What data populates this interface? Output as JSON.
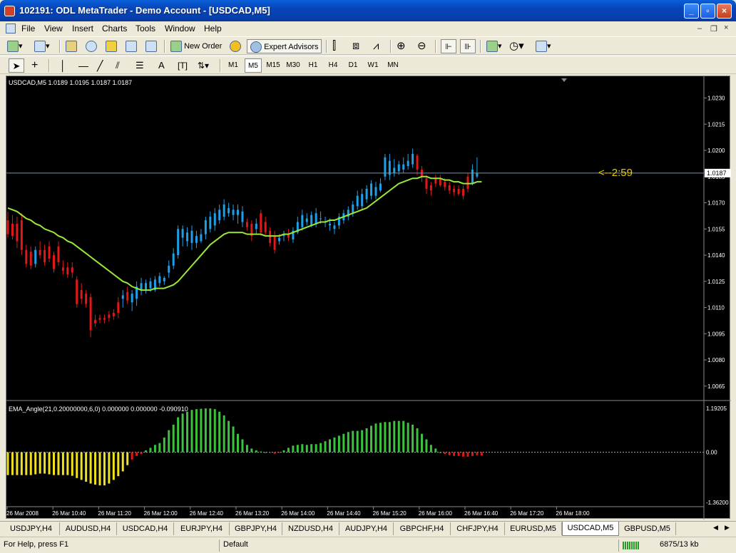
{
  "window": {
    "title": "102191: ODL MetaTrader - Demo Account - [USDCAD,M5]"
  },
  "menu": [
    "File",
    "View",
    "Insert",
    "Charts",
    "Tools",
    "Window",
    "Help"
  ],
  "toolbar": {
    "new_order": "New Order",
    "expert_advisors": "Expert Advisors"
  },
  "timeframes": [
    "M1",
    "M5",
    "M15",
    "M30",
    "H1",
    "H4",
    "D1",
    "W1",
    "MN"
  ],
  "active_timeframe": "M5",
  "chart": {
    "header": "USDCAD,M5  1.0189 1.0195 1.0187 1.0187",
    "current_price": "1.0187",
    "countdown": "<--2:59",
    "price_ticks": [
      "1.0230",
      "1.0215",
      "1.0200",
      "1.0185",
      "1.0170",
      "1.0155",
      "1.0140",
      "1.0125",
      "1.0110",
      "1.0095",
      "1.0080",
      "1.0065"
    ],
    "indicator_header": "EMA_Angle(21,0.20000000,6,0) 0.000000 0.000000 -0.090910",
    "indicator_ticks": [
      "1.19205",
      "0.00",
      "-1.36200"
    ],
    "time_ticks": [
      "26 Mar 2008",
      "26 Mar 10:40",
      "26 Mar 11:20",
      "26 Mar 12:00",
      "26 Mar 12:40",
      "26 Mar 13:20",
      "26 Mar 14:00",
      "26 Mar 14:40",
      "26 Mar 15:20",
      "26 Mar 16:00",
      "26 Mar 16:40",
      "26 Mar 17:20",
      "26 Mar 18:00"
    ],
    "colors": {
      "bull": "#1ea0e8",
      "bear": "#e01818",
      "ema": "#9ae639",
      "ind_pos": "#3cc23c",
      "ind_neg_yellow": "#f0e020",
      "ind_neg_red": "#e01818",
      "countdown": "#e6c800"
    }
  },
  "chart_data": {
    "type": "candlestick",
    "symbol": "USDCAD",
    "timeframe": "M5",
    "ylim": [
      1.0058,
      1.024
    ],
    "bars": [
      {
        "o": 1.016,
        "h": 1.0165,
        "l": 1.015,
        "c": 1.0152
      },
      {
        "o": 1.0158,
        "h": 1.0163,
        "l": 1.0149,
        "c": 1.0151
      },
      {
        "o": 1.0158,
        "h": 1.0162,
        "l": 1.0144,
        "c": 1.0148
      },
      {
        "o": 1.016,
        "h": 1.0164,
        "l": 1.014,
        "c": 1.0143
      },
      {
        "o": 1.0143,
        "h": 1.0146,
        "l": 1.0133,
        "c": 1.0135
      },
      {
        "o": 1.0142,
        "h": 1.0145,
        "l": 1.0132,
        "c": 1.0134
      },
      {
        "o": 1.0135,
        "h": 1.0145,
        "l": 1.0133,
        "c": 1.0143
      },
      {
        "o": 1.0143,
        "h": 1.0148,
        "l": 1.0138,
        "c": 1.014
      },
      {
        "o": 1.0143,
        "h": 1.0146,
        "l": 1.0134,
        "c": 1.0136
      },
      {
        "o": 1.0145,
        "h": 1.0148,
        "l": 1.0136,
        "c": 1.0138
      },
      {
        "o": 1.014,
        "h": 1.0142,
        "l": 1.013,
        "c": 1.0132
      },
      {
        "o": 1.0145,
        "h": 1.0148,
        "l": 1.0134,
        "c": 1.0136
      },
      {
        "o": 1.0133,
        "h": 1.0137,
        "l": 1.0129,
        "c": 1.0131
      },
      {
        "o": 1.0133,
        "h": 1.0136,
        "l": 1.0127,
        "c": 1.0129
      },
      {
        "o": 1.0133,
        "h": 1.0136,
        "l": 1.0127,
        "c": 1.013
      },
      {
        "o": 1.0126,
        "h": 1.0128,
        "l": 1.011,
        "c": 1.0112
      },
      {
        "o": 1.012,
        "h": 1.0124,
        "l": 1.0112,
        "c": 1.0115
      },
      {
        "o": 1.0118,
        "h": 1.012,
        "l": 1.011,
        "c": 1.0112
      },
      {
        "o": 1.0116,
        "h": 1.0118,
        "l": 1.0093,
        "c": 1.0097
      },
      {
        "o": 1.0103,
        "h": 1.0106,
        "l": 1.0099,
        "c": 1.0101
      },
      {
        "o": 1.0104,
        "h": 1.0106,
        "l": 1.0101,
        "c": 1.0103
      },
      {
        "o": 1.0104,
        "h": 1.0106,
        "l": 1.0101,
        "c": 1.0103
      },
      {
        "o": 1.0106,
        "h": 1.0108,
        "l": 1.0102,
        "c": 1.0104
      },
      {
        "o": 1.0107,
        "h": 1.0109,
        "l": 1.0103,
        "c": 1.0105
      },
      {
        "o": 1.0113,
        "h": 1.0116,
        "l": 1.0104,
        "c": 1.0107
      },
      {
        "o": 1.0115,
        "h": 1.012,
        "l": 1.011,
        "c": 1.0117
      },
      {
        "o": 1.0119,
        "h": 1.0122,
        "l": 1.0112,
        "c": 1.0114
      },
      {
        "o": 1.0113,
        "h": 1.012,
        "l": 1.0108,
        "c": 1.0118
      },
      {
        "o": 1.0115,
        "h": 1.0125,
        "l": 1.0111,
        "c": 1.0122
      },
      {
        "o": 1.012,
        "h": 1.0127,
        "l": 1.0117,
        "c": 1.0124
      },
      {
        "o": 1.012,
        "h": 1.0126,
        "l": 1.0118,
        "c": 1.0124
      },
      {
        "o": 1.0121,
        "h": 1.0127,
        "l": 1.0119,
        "c": 1.0125
      },
      {
        "o": 1.012,
        "h": 1.0128,
        "l": 1.0119,
        "c": 1.0126
      },
      {
        "o": 1.0124,
        "h": 1.013,
        "l": 1.0122,
        "c": 1.0128
      },
      {
        "o": 1.0125,
        "h": 1.0128,
        "l": 1.0123,
        "c": 1.0127
      },
      {
        "o": 1.013,
        "h": 1.0137,
        "l": 1.0127,
        "c": 1.0134
      },
      {
        "o": 1.0134,
        "h": 1.0144,
        "l": 1.0132,
        "c": 1.0141
      },
      {
        "o": 1.014,
        "h": 1.0157,
        "l": 1.0138,
        "c": 1.0155
      },
      {
        "o": 1.015,
        "h": 1.0157,
        "l": 1.0145,
        "c": 1.0155
      },
      {
        "o": 1.0148,
        "h": 1.0156,
        "l": 1.0145,
        "c": 1.0153
      },
      {
        "o": 1.0147,
        "h": 1.0157,
        "l": 1.0143,
        "c": 1.0154
      },
      {
        "o": 1.0147,
        "h": 1.0154,
        "l": 1.0144,
        "c": 1.0151
      },
      {
        "o": 1.0148,
        "h": 1.0155,
        "l": 1.0147,
        "c": 1.0152
      },
      {
        "o": 1.0152,
        "h": 1.0162,
        "l": 1.0149,
        "c": 1.016
      },
      {
        "o": 1.0155,
        "h": 1.0165,
        "l": 1.0153,
        "c": 1.0162
      },
      {
        "o": 1.0157,
        "h": 1.0167,
        "l": 1.0154,
        "c": 1.0164
      },
      {
        "o": 1.016,
        "h": 1.0169,
        "l": 1.0158,
        "c": 1.0166
      },
      {
        "o": 1.0162,
        "h": 1.0172,
        "l": 1.016,
        "c": 1.0169
      },
      {
        "o": 1.0164,
        "h": 1.017,
        "l": 1.0162,
        "c": 1.0167
      },
      {
        "o": 1.0163,
        "h": 1.0169,
        "l": 1.016,
        "c": 1.0166
      },
      {
        "o": 1.0163,
        "h": 1.0169,
        "l": 1.0158,
        "c": 1.0166
      },
      {
        "o": 1.0159,
        "h": 1.0168,
        "l": 1.0156,
        "c": 1.0165
      },
      {
        "o": 1.0159,
        "h": 1.0161,
        "l": 1.0154,
        "c": 1.0156
      },
      {
        "o": 1.0158,
        "h": 1.016,
        "l": 1.0148,
        "c": 1.0151
      },
      {
        "o": 1.0155,
        "h": 1.0161,
        "l": 1.0152,
        "c": 1.0158
      },
      {
        "o": 1.0164,
        "h": 1.0166,
        "l": 1.0151,
        "c": 1.0153
      },
      {
        "o": 1.0159,
        "h": 1.0162,
        "l": 1.0151,
        "c": 1.0153
      },
      {
        "o": 1.0154,
        "h": 1.0156,
        "l": 1.0145,
        "c": 1.0147
      },
      {
        "o": 1.0151,
        "h": 1.0154,
        "l": 1.0141,
        "c": 1.0143
      },
      {
        "o": 1.0148,
        "h": 1.0152,
        "l": 1.0146,
        "c": 1.015
      },
      {
        "o": 1.0151,
        "h": 1.0154,
        "l": 1.0148,
        "c": 1.0152
      },
      {
        "o": 1.0152,
        "h": 1.0155,
        "l": 1.0148,
        "c": 1.015
      },
      {
        "o": 1.0149,
        "h": 1.0156,
        "l": 1.0147,
        "c": 1.0154
      },
      {
        "o": 1.0153,
        "h": 1.0162,
        "l": 1.0152,
        "c": 1.0159
      },
      {
        "o": 1.0156,
        "h": 1.0166,
        "l": 1.0154,
        "c": 1.0163
      },
      {
        "o": 1.0159,
        "h": 1.0164,
        "l": 1.0157,
        "c": 1.0161
      },
      {
        "o": 1.0157,
        "h": 1.0165,
        "l": 1.0156,
        "c": 1.0163
      },
      {
        "o": 1.0158,
        "h": 1.0167,
        "l": 1.0156,
        "c": 1.0164
      },
      {
        "o": 1.0161,
        "h": 1.0165,
        "l": 1.0158,
        "c": 1.0161
      },
      {
        "o": 1.0159,
        "h": 1.0162,
        "l": 1.0156,
        "c": 1.0159
      },
      {
        "o": 1.0157,
        "h": 1.0161,
        "l": 1.0154,
        "c": 1.0158
      },
      {
        "o": 1.0155,
        "h": 1.0159,
        "l": 1.0152,
        "c": 1.0157
      },
      {
        "o": 1.0157,
        "h": 1.0164,
        "l": 1.0155,
        "c": 1.0162
      },
      {
        "o": 1.016,
        "h": 1.0166,
        "l": 1.0158,
        "c": 1.0164
      },
      {
        "o": 1.0162,
        "h": 1.0168,
        "l": 1.016,
        "c": 1.0166
      },
      {
        "o": 1.0164,
        "h": 1.0171,
        "l": 1.0162,
        "c": 1.0169
      },
      {
        "o": 1.0168,
        "h": 1.0177,
        "l": 1.0166,
        "c": 1.0174
      },
      {
        "o": 1.0168,
        "h": 1.0178,
        "l": 1.0166,
        "c": 1.0175
      },
      {
        "o": 1.0172,
        "h": 1.018,
        "l": 1.017,
        "c": 1.0178
      },
      {
        "o": 1.0174,
        "h": 1.0183,
        "l": 1.0172,
        "c": 1.0181
      },
      {
        "o": 1.0174,
        "h": 1.0182,
        "l": 1.0172,
        "c": 1.0179
      },
      {
        "o": 1.0177,
        "h": 1.0184,
        "l": 1.0176,
        "c": 1.0181
      },
      {
        "o": 1.0185,
        "h": 1.0198,
        "l": 1.0183,
        "c": 1.0196
      },
      {
        "o": 1.0186,
        "h": 1.0198,
        "l": 1.0183,
        "c": 1.0194
      },
      {
        "o": 1.0187,
        "h": 1.0195,
        "l": 1.0185,
        "c": 1.019
      },
      {
        "o": 1.0188,
        "h": 1.0194,
        "l": 1.0186,
        "c": 1.0192
      },
      {
        "o": 1.0189,
        "h": 1.0196,
        "l": 1.0187,
        "c": 1.0192
      },
      {
        "o": 1.0191,
        "h": 1.0198,
        "l": 1.0189,
        "c": 1.0194
      },
      {
        "o": 1.0192,
        "h": 1.0201,
        "l": 1.019,
        "c": 1.0198
      },
      {
        "o": 1.0197,
        "h": 1.0198,
        "l": 1.0186,
        "c": 1.0189
      },
      {
        "o": 1.0189,
        "h": 1.0191,
        "l": 1.0182,
        "c": 1.0185
      },
      {
        "o": 1.0184,
        "h": 1.0186,
        "l": 1.0175,
        "c": 1.0178
      },
      {
        "o": 1.018,
        "h": 1.0182,
        "l": 1.0174,
        "c": 1.0177
      },
      {
        "o": 1.0184,
        "h": 1.0186,
        "l": 1.0179,
        "c": 1.0181
      },
      {
        "o": 1.0184,
        "h": 1.0186,
        "l": 1.0179,
        "c": 1.018
      },
      {
        "o": 1.0182,
        "h": 1.0184,
        "l": 1.0177,
        "c": 1.0179
      },
      {
        "o": 1.018,
        "h": 1.0182,
        "l": 1.0175,
        "c": 1.0177
      },
      {
        "o": 1.0178,
        "h": 1.018,
        "l": 1.0174,
        "c": 1.0176
      },
      {
        "o": 1.0178,
        "h": 1.018,
        "l": 1.0174,
        "c": 1.0175
      },
      {
        "o": 1.0178,
        "h": 1.018,
        "l": 1.0172,
        "c": 1.0174
      },
      {
        "o": 1.0185,
        "h": 1.0187,
        "l": 1.0176,
        "c": 1.0178
      },
      {
        "o": 1.0181,
        "h": 1.0192,
        "l": 1.018,
        "c": 1.0189
      },
      {
        "o": 1.0185,
        "h": 1.0196,
        "l": 1.0184,
        "c": 1.0187
      }
    ],
    "ema": [
      1.0167,
      1.0166,
      1.0165,
      1.0163,
      1.0161,
      1.016,
      1.0158,
      1.0157,
      1.0155,
      1.0154,
      1.0153,
      1.0151,
      1.015,
      1.0148,
      1.0147,
      1.0145,
      1.0143,
      1.0141,
      1.0139,
      1.0137,
      1.0135,
      1.0133,
      1.0131,
      1.0129,
      1.0127,
      1.0125,
      1.0124,
      1.0122,
      1.0121,
      1.012,
      1.012,
      1.012,
      1.0121,
      1.0121,
      1.0121,
      1.0122,
      1.0123,
      1.0125,
      1.0128,
      1.0131,
      1.0134,
      1.0137,
      1.014,
      1.0143,
      1.0146,
      1.0148,
      1.015,
      1.0152,
      1.0153,
      1.0153,
      1.0153,
      1.0153,
      1.0152,
      1.0152,
      1.0152,
      1.0152,
      1.0151,
      1.0151,
      1.0151,
      1.0151,
      1.0152,
      1.0152,
      1.0153,
      1.0154,
      1.0155,
      1.0156,
      1.0157,
      1.0158,
      1.0159,
      1.0159,
      1.016,
      1.016,
      1.0161,
      1.0162,
      1.0163,
      1.0164,
      1.0165,
      1.0166,
      1.0167,
      1.0169,
      1.0171,
      1.0173,
      1.0175,
      1.0177,
      1.0179,
      1.0181,
      1.0182,
      1.0183,
      1.0184,
      1.0184,
      1.0185,
      1.0185,
      1.0184,
      1.0184,
      1.0184,
      1.0183,
      1.0183,
      1.0182,
      1.0182,
      1.0181,
      1.0181,
      1.0181,
      1.0182,
      1.0182
    ],
    "indicator": {
      "name": "EMA_Angle(21,0.20000000,6,0)",
      "ylim": [
        -1.362,
        1.19205
      ],
      "values": [
        -0.62,
        -0.62,
        -0.62,
        -0.62,
        -0.62,
        -0.62,
        -0.6,
        -0.58,
        -0.58,
        -0.6,
        -0.62,
        -0.62,
        -0.62,
        -0.62,
        -0.64,
        -0.7,
        -0.75,
        -0.8,
        -0.85,
        -0.88,
        -0.9,
        -0.9,
        -0.85,
        -0.75,
        -0.65,
        -0.52,
        -0.35,
        -0.2,
        -0.1,
        -0.05,
        0.05,
        0.12,
        0.2,
        0.25,
        0.4,
        0.6,
        0.75,
        0.95,
        1.05,
        1.1,
        1.15,
        1.17,
        1.18,
        1.19,
        1.19,
        1.17,
        1.1,
        1.0,
        0.85,
        0.7,
        0.5,
        0.35,
        0.2,
        0.1,
        0.05,
        0.02,
        0.0,
        -0.02,
        -0.04,
        -0.02,
        0.05,
        0.12,
        0.18,
        0.2,
        0.22,
        0.2,
        0.22,
        0.22,
        0.25,
        0.3,
        0.35,
        0.4,
        0.45,
        0.5,
        0.55,
        0.58,
        0.58,
        0.6,
        0.65,
        0.72,
        0.78,
        0.8,
        0.82,
        0.82,
        0.85,
        0.85,
        0.85,
        0.8,
        0.75,
        0.65,
        0.5,
        0.35,
        0.2,
        0.1,
        0.0,
        -0.05,
        -0.08,
        -0.1,
        -0.1,
        -0.12,
        -0.12,
        -0.1,
        -0.08,
        -0.09
      ]
    }
  },
  "symbol_tabs": [
    "USDJPY,H4",
    "AUDUSD,H4",
    "USDCAD,H4",
    "EURJPY,H4",
    "GBPJPY,H4",
    "NZDUSD,H4",
    "AUDJPY,H4",
    "GBPCHF,H4",
    "CHFJPY,H4",
    "EURUSD,M5",
    "USDCAD,M5",
    "GBPUSD,M5"
  ],
  "active_tab": "USDCAD,M5",
  "status": {
    "help": "For Help, press F1",
    "profile": "Default",
    "traffic": "6875/13 kb"
  }
}
